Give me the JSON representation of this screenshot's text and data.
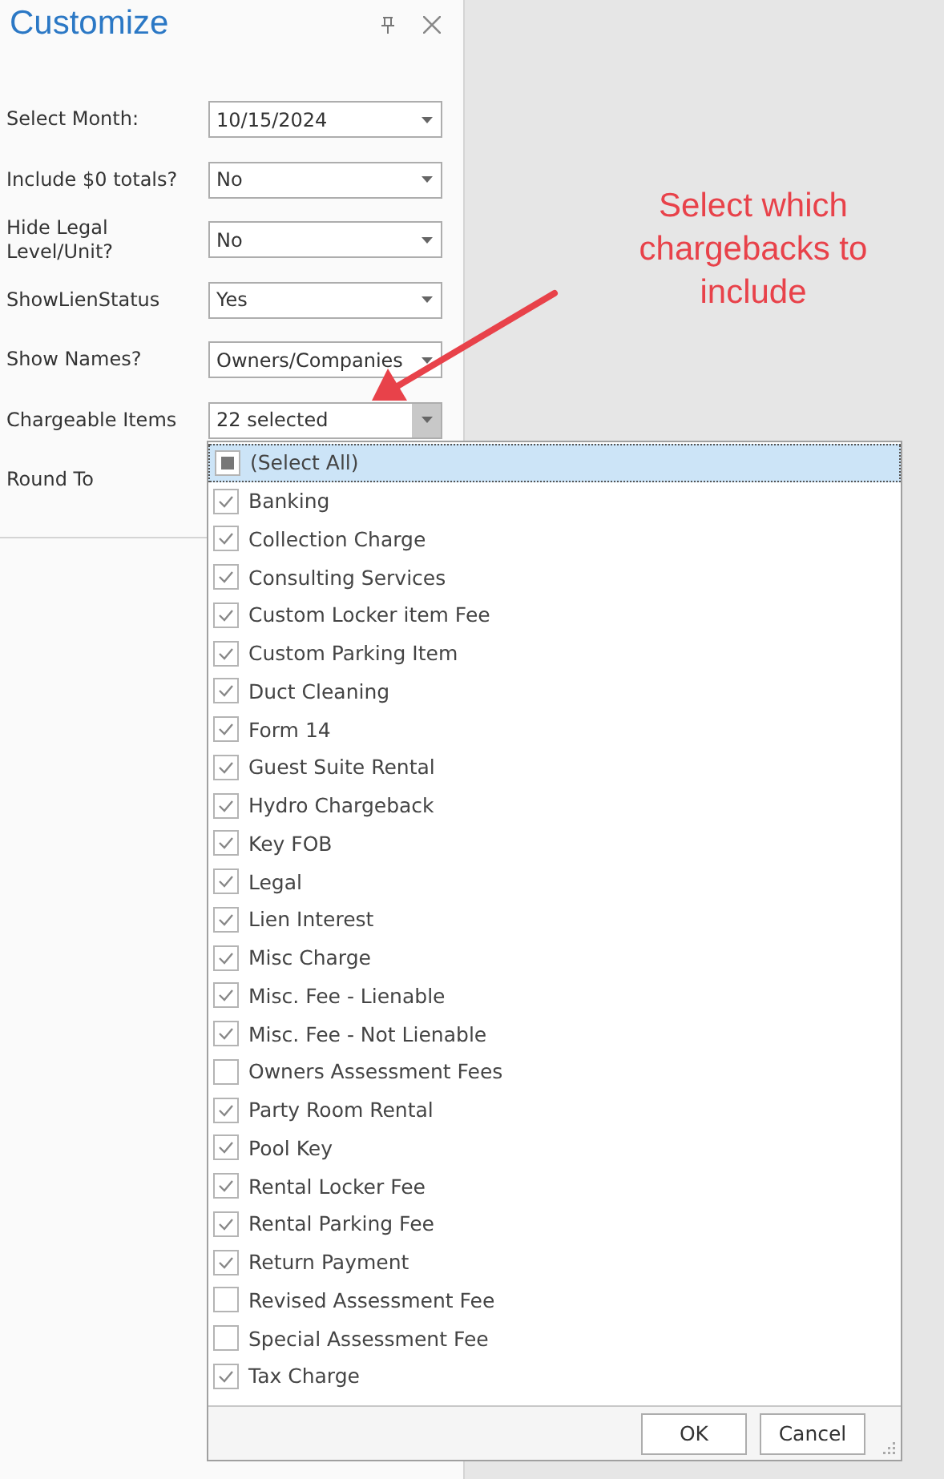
{
  "panel": {
    "title": "Customize"
  },
  "fields": [
    {
      "label": "Select Month:",
      "value": "10/15/2024",
      "open": false
    },
    {
      "label": "Include $0 totals?",
      "value": "No",
      "open": false
    },
    {
      "label": "Hide Legal Level/Unit?",
      "value": "No",
      "open": false
    },
    {
      "label": "ShowLienStatus",
      "value": "Yes",
      "open": false
    },
    {
      "label": "Show Names?",
      "value": "Owners/Companies",
      "open": false
    },
    {
      "label": "Chargeable Items",
      "value": "22 selected",
      "open": true
    },
    {
      "label": "Round To"
    }
  ],
  "dropdown": {
    "select_all": {
      "label": "(Select All)",
      "indeterminate": true,
      "selected": true
    },
    "items": [
      {
        "label": "Banking",
        "checked": true
      },
      {
        "label": "Collection Charge",
        "checked": true
      },
      {
        "label": "Consulting Services",
        "checked": true
      },
      {
        "label": "Custom Locker item Fee",
        "checked": true
      },
      {
        "label": "Custom Parking Item",
        "checked": true
      },
      {
        "label": "Duct Cleaning",
        "checked": true
      },
      {
        "label": "Form 14",
        "checked": true
      },
      {
        "label": "Guest Suite Rental",
        "checked": true
      },
      {
        "label": "Hydro Chargeback",
        "checked": true
      },
      {
        "label": "Key FOB",
        "checked": true
      },
      {
        "label": "Legal",
        "checked": true
      },
      {
        "label": "Lien Interest",
        "checked": true
      },
      {
        "label": "Misc Charge",
        "checked": true
      },
      {
        "label": "Misc. Fee - Lienable",
        "checked": true
      },
      {
        "label": "Misc. Fee - Not Lienable",
        "checked": true
      },
      {
        "label": "Owners Assessment Fees",
        "checked": false
      },
      {
        "label": "Party Room Rental",
        "checked": true
      },
      {
        "label": "Pool Key",
        "checked": true
      },
      {
        "label": "Rental Locker Fee",
        "checked": true
      },
      {
        "label": "Rental Parking Fee",
        "checked": true
      },
      {
        "label": "Return Payment",
        "checked": true
      },
      {
        "label": "Revised Assessment Fee",
        "checked": false
      },
      {
        "label": "Special Assessment Fee",
        "checked": false
      },
      {
        "label": "Tax Charge",
        "checked": true
      }
    ],
    "buttons": [
      "OK",
      "Cancel"
    ]
  },
  "annotation": {
    "text": "Select which chargebacks to include"
  }
}
